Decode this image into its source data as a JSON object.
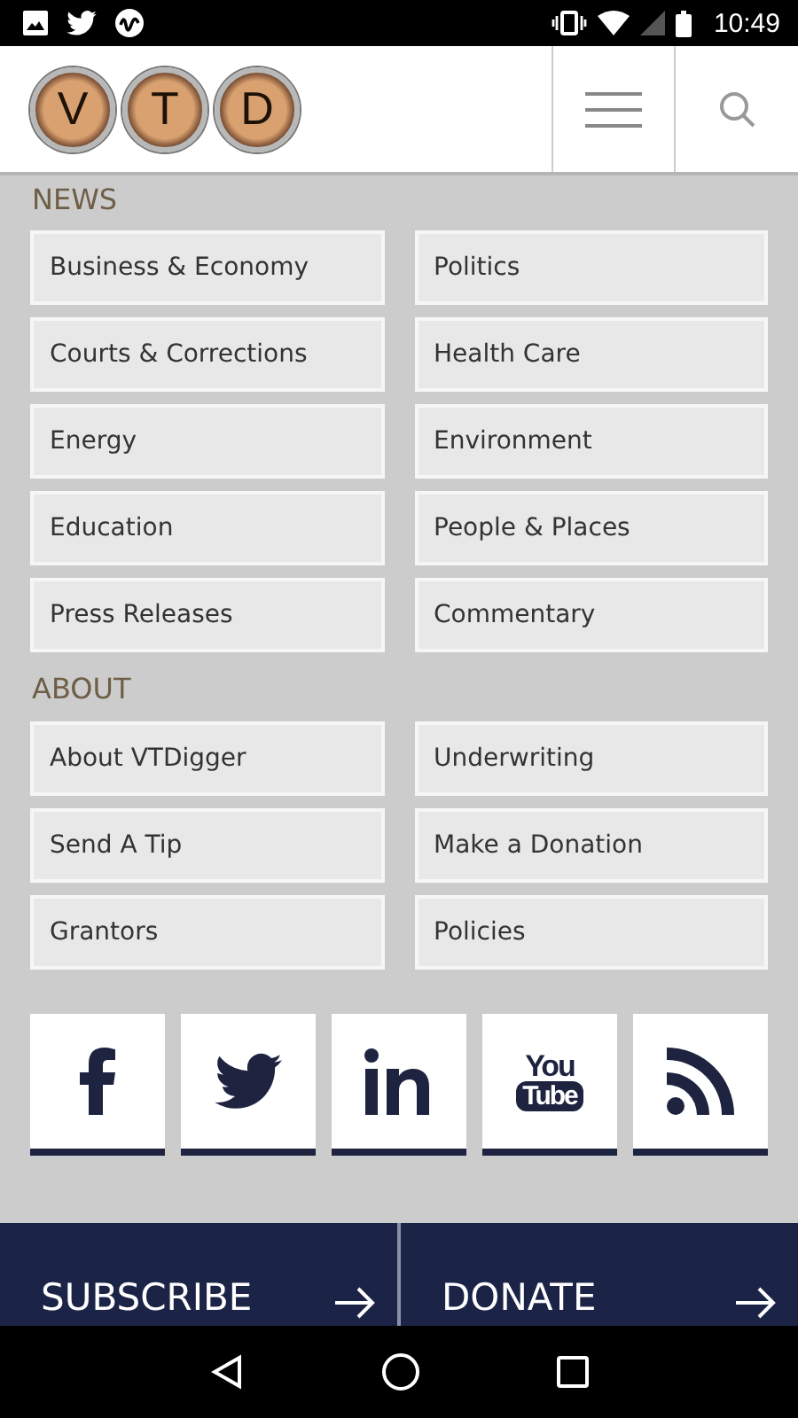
{
  "status_bar": {
    "time": "10:49"
  },
  "logo": {
    "letters": [
      "V",
      "T",
      "D"
    ]
  },
  "sections": [
    {
      "title": "NEWS",
      "items": [
        "Business & Economy",
        "Politics",
        "Courts & Corrections",
        "Health Care",
        "Energy",
        "Environment",
        "Education",
        "People & Places",
        "Press Releases",
        "Commentary"
      ]
    },
    {
      "title": "ABOUT",
      "items": [
        "About VTDigger",
        "Underwriting",
        "Send A Tip",
        "Make a Donation",
        "Grantors",
        "Policies"
      ]
    }
  ],
  "social": [
    {
      "kind": "facebook"
    },
    {
      "kind": "twitter"
    },
    {
      "kind": "linkedin"
    },
    {
      "kind": "youtube",
      "text_top": "You",
      "text_bottom": "Tube"
    },
    {
      "kind": "rss"
    }
  ],
  "actions": [
    "SUBSCRIBE",
    "DONATE"
  ]
}
